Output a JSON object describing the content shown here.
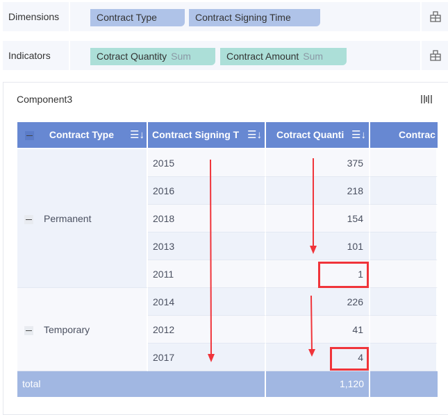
{
  "dimensions": {
    "label": "Dimensions",
    "fields": [
      "Contract Type",
      "Contract Signing Time"
    ]
  },
  "indicators": {
    "label": "Indicators",
    "fields": [
      {
        "name": "Cotract Quantity",
        "agg": "Sum"
      },
      {
        "name": "Contract Amount",
        "agg": "Sum"
      }
    ]
  },
  "component": {
    "title": "Component3"
  },
  "table": {
    "headers": [
      "Contract Type",
      "Contract Signing T",
      "Cotract Quanti",
      "Contrac"
    ],
    "groups": [
      {
        "type": "Permanent",
        "rows": [
          {
            "year": "2015",
            "qty": "375"
          },
          {
            "year": "2016",
            "qty": "218"
          },
          {
            "year": "2018",
            "qty": "154"
          },
          {
            "year": "2013",
            "qty": "101"
          },
          {
            "year": "2011",
            "qty": "1"
          }
        ]
      },
      {
        "type": "Temporary",
        "rows": [
          {
            "year": "2014",
            "qty": "226"
          },
          {
            "year": "2012",
            "qty": "41"
          },
          {
            "year": "2017",
            "qty": "4"
          }
        ]
      }
    ],
    "total": {
      "label": "total",
      "qty": "1,120"
    }
  },
  "colors": {
    "header": "#6788d2",
    "total": "#a1b7e2",
    "annotation": "#f0343a"
  }
}
